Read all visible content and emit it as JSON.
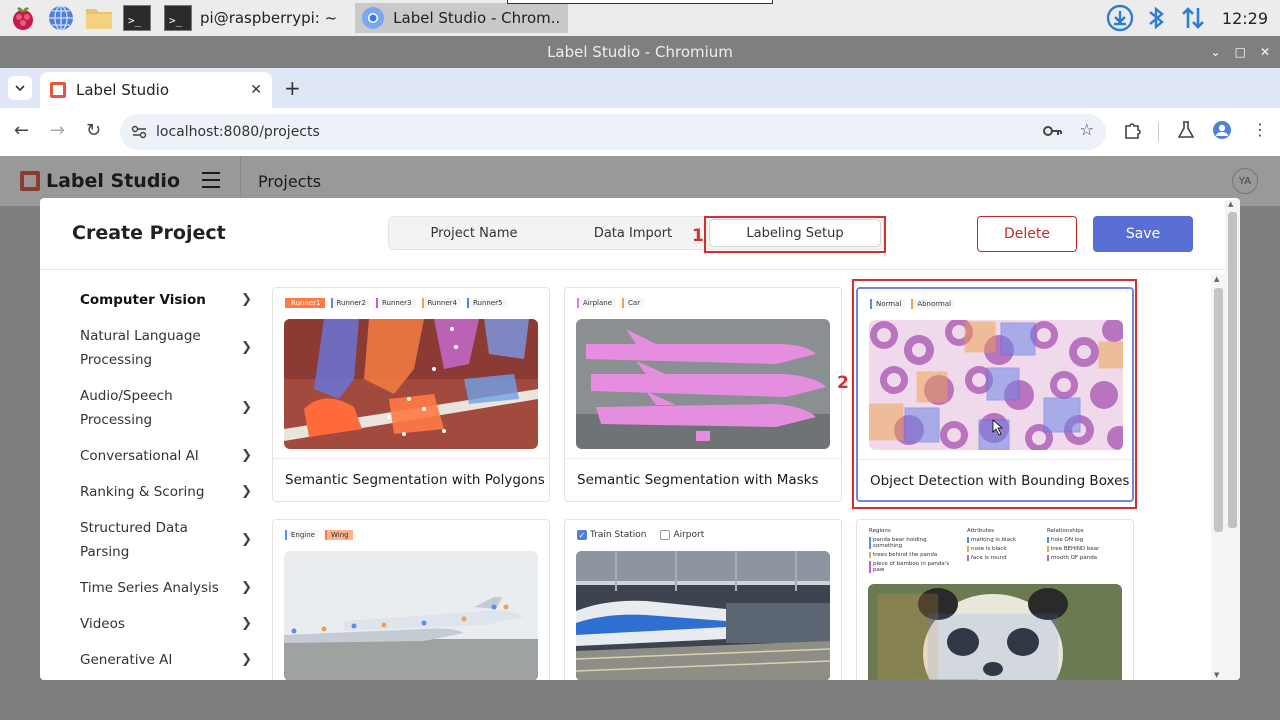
{
  "taskbar": {
    "terminal_task_label": "pi@raspberrypi: ~",
    "browser_task_label": "Label Studio - Chrom..",
    "clock": "12:29"
  },
  "window": {
    "title": "Label Studio - Chromium"
  },
  "browser": {
    "tab_title": "Label Studio",
    "url": "localhost:8080/projects"
  },
  "app": {
    "logo_text": "Label Studio",
    "page_title": "Projects",
    "avatar_initials": "YA"
  },
  "modal": {
    "title": "Create Project",
    "tabs": [
      "Project Name",
      "Data Import",
      "Labeling Setup"
    ],
    "active_tab": "Labeling Setup",
    "delete_label": "Delete",
    "save_label": "Save",
    "annotation_1": "1",
    "annotation_2": "2"
  },
  "sidebar": {
    "items": [
      "Computer Vision",
      "Natural Language Processing",
      "Audio/Speech Processing",
      "Conversational AI",
      "Ranking & Scoring",
      "Structured Data Parsing",
      "Time Series Analysis",
      "Videos",
      "Generative AI"
    ]
  },
  "templates": [
    {
      "title": "Semantic Segmentation with Polygons",
      "labels": [
        "Runner1",
        "Runner2",
        "Runner3",
        "Runner4",
        "Runner5"
      ]
    },
    {
      "title": "Semantic Segmentation with Masks",
      "labels": [
        "Airplane",
        "Car"
      ]
    },
    {
      "title": "Object Detection with Bounding Boxes",
      "labels": [
        "Normal",
        "Abnormal"
      ]
    },
    {
      "title": "",
      "labels": [
        "Engine",
        "Wing"
      ]
    },
    {
      "title": "",
      "labels": [
        "Train Station",
        "Airport"
      ]
    },
    {
      "title": "",
      "columns": [
        "Regions",
        "Attributes",
        "Relationships"
      ],
      "regions": [
        "panda bear holding something",
        "trees behind the panda",
        "piece of bamboo in panda's paw"
      ],
      "attributes": [
        "marking is black",
        "nose is black",
        "face is round"
      ],
      "relationships": [
        "hole ON log",
        "tree BEHIND bear",
        "mouth OF panda"
      ]
    }
  ],
  "colors": {
    "accent": "#5a6fd6",
    "danger": "#c62828",
    "highlight": "#d32f2f"
  }
}
